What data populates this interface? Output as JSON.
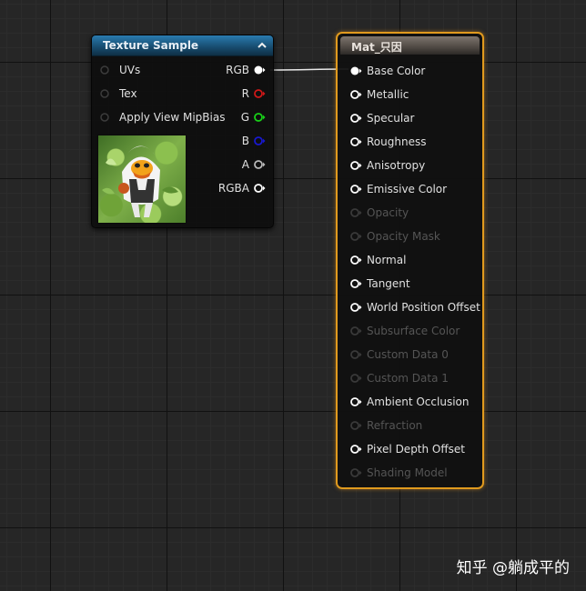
{
  "texture_node": {
    "title": "Texture Sample",
    "inputs": [
      {
        "label": "UVs"
      },
      {
        "label": "Tex"
      },
      {
        "label": "Apply View MipBias"
      }
    ],
    "outputs": [
      {
        "label": "RGB",
        "pin_color": "#ffffff",
        "connected": true
      },
      {
        "label": "R",
        "pin_color": "#d01818",
        "connected": false
      },
      {
        "label": "G",
        "pin_color": "#18d018",
        "connected": false
      },
      {
        "label": "B",
        "pin_color": "#1818d0",
        "connected": false
      },
      {
        "label": "A",
        "pin_color": "#b8b8b8",
        "connected": false
      },
      {
        "label": "RGBA",
        "pin_color": "#ffffff",
        "connected": false
      }
    ]
  },
  "material_node": {
    "title": "Mat_只因",
    "accent": "#e09a1e",
    "pins": [
      {
        "label": "Base Color",
        "enabled": true,
        "connected": true
      },
      {
        "label": "Metallic",
        "enabled": true,
        "connected": false
      },
      {
        "label": "Specular",
        "enabled": true,
        "connected": false
      },
      {
        "label": "Roughness",
        "enabled": true,
        "connected": false
      },
      {
        "label": "Anisotropy",
        "enabled": true,
        "connected": false
      },
      {
        "label": "Emissive Color",
        "enabled": true,
        "connected": false
      },
      {
        "label": "Opacity",
        "enabled": false,
        "connected": false
      },
      {
        "label": "Opacity Mask",
        "enabled": false,
        "connected": false
      },
      {
        "label": "Normal",
        "enabled": true,
        "connected": false
      },
      {
        "label": "Tangent",
        "enabled": true,
        "connected": false
      },
      {
        "label": "World Position Offset",
        "enabled": true,
        "connected": false
      },
      {
        "label": "Subsurface Color",
        "enabled": false,
        "connected": false
      },
      {
        "label": "Custom Data 0",
        "enabled": false,
        "connected": false
      },
      {
        "label": "Custom Data 1",
        "enabled": false,
        "connected": false
      },
      {
        "label": "Ambient Occlusion",
        "enabled": true,
        "connected": false
      },
      {
        "label": "Refraction",
        "enabled": false,
        "connected": false
      },
      {
        "label": "Pixel Depth Offset",
        "enabled": true,
        "connected": false
      },
      {
        "label": "Shading Model",
        "enabled": false,
        "connected": false
      }
    ]
  },
  "watermark": "知乎 @躺成平的"
}
